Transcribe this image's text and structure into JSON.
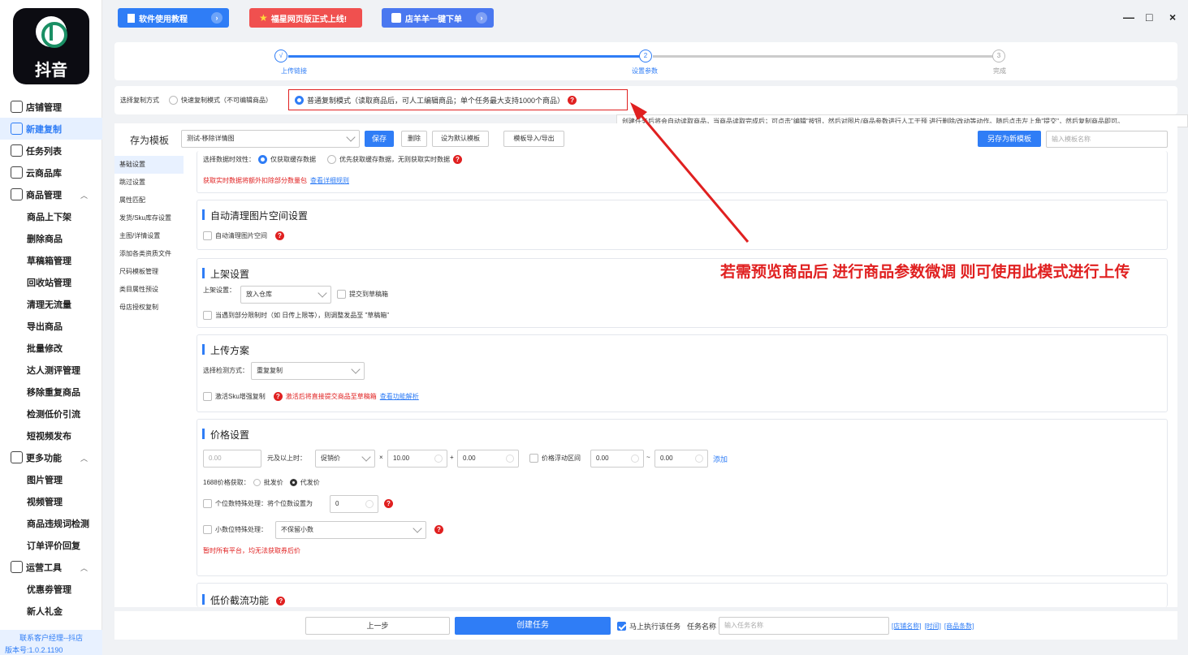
{
  "brand": {
    "name": "抖音"
  },
  "sidebar": {
    "items": [
      {
        "label": "店铺管理",
        "icon": "store-icon"
      },
      {
        "label": "新建复制",
        "icon": "add-copy-icon",
        "active": true
      },
      {
        "label": "任务列表",
        "icon": "task-list-icon"
      },
      {
        "label": "云商品库",
        "icon": "cloud-library-icon"
      },
      {
        "label": "商品管理",
        "icon": "cube-icon",
        "expandable": true
      }
    ],
    "goods_sub": [
      "商品上下架",
      "删除商品",
      "草稿箱管理",
      "回收站管理",
      "清理无流量",
      "导出商品",
      "批量修改",
      "达人测评管理",
      "移除重复商品",
      "检测低价引流",
      "短视频发布"
    ],
    "more": {
      "label": "更多功能",
      "icon": "grid-icon"
    },
    "more_sub": [
      "图片管理",
      "视频管理",
      "商品违规词检测",
      "订单评价回复"
    ],
    "ops": {
      "label": "运营工具",
      "icon": "tools-icon"
    },
    "ops_sub": [
      "优惠劵管理",
      "新人礼金"
    ],
    "contact": "联系客户经理--抖店",
    "version": "版本号:1.0.2.1190"
  },
  "topbar": {
    "tutorial": "软件使用教程",
    "web_launch": "福星网页版正式上线!",
    "order": "店羊羊一键下单",
    "minimize": "—",
    "maximize": "□",
    "close": "×"
  },
  "stepper": {
    "steps": [
      {
        "num": "√",
        "label": "上传链接"
      },
      {
        "num": "2",
        "label": "设置参数"
      },
      {
        "num": "3",
        "label": "完成"
      }
    ]
  },
  "copy_mode": {
    "label": "选择复制方式",
    "fast": "快速复制模式（不可编辑商品）",
    "normal": "普通复制模式（读取商品后，可人工编辑商品；单个任务最大支持1000个商品）",
    "tooltip": "创建任务后将会自动读取商品，当商品读取完成后；可点击\"编辑\"按钮，然后对图片/商品参数进行人工干预 进行删除/改动等动作。随后点击左上角\"提交\"，然后复制商品即可。"
  },
  "template": {
    "label": "存为模板",
    "selected": "测试-移除详情图",
    "save": "保存",
    "delete": "删除",
    "set_default": "设为默认模板",
    "import_export": "模板导入/导出",
    "save_new": "另存为新模板",
    "name_placeholder": "输入模板名称"
  },
  "settings_nav": [
    "基础设置",
    "跳过设置",
    "属性匹配",
    "发货/Sku库存设置",
    "主图/详情设置",
    "添加各类资质文件",
    "尺码模板管理",
    "类目属性预设",
    "母店授权复制"
  ],
  "basic": {
    "timeliness": "选择数据时效性：",
    "cache_only": "仅获取缓存数据",
    "cache_first": "优先获取缓存数据，无则获取实时数据",
    "realtime_note": "获取实时数据将额外扣除部分数量包",
    "rules_link": "查看详细规则"
  },
  "auto_clean": {
    "title": "自动清理图片空间设置",
    "option": "自动清理图片空间"
  },
  "listing": {
    "title": "上架设置",
    "label": "上架设置：",
    "value": "放入仓库",
    "submit_draft": "提交到草稿箱",
    "limit_note": "当遇到部分限制时（如 日传上限等），则调整发品至 \"草稿箱\""
  },
  "upload_plan": {
    "title": "上传方案",
    "detect_label": "选择检测方式：",
    "detect_value": "重复复制",
    "sku_enhance": "激活Sku增强复制",
    "sku_note": "激活后将直接提交商品至草稿箱",
    "sku_link": "查看功能解析"
  },
  "price": {
    "title": "价格设置",
    "min_placeholder": "0.00",
    "above_label": "元及以上时：",
    "price_type": "促销价",
    "times": "×",
    "multiplier": "10.00",
    "plus": "+",
    "addend": "0.00",
    "float_label": "价格浮动区间",
    "float_min": "0.00",
    "tilde": "~",
    "float_max": "0.00",
    "add_link": "添加",
    "source_label": "1688价格获取：",
    "wholesale": "批发价",
    "dropship": "代发价",
    "units_label": "个位数特殊处理：将个位数设置为",
    "units_value": "0",
    "decimal_label": "小数位特殊处理：",
    "decimal_value": "不保留小数",
    "notice": "暂时所有平台，均无法获取券后价"
  },
  "low_price": {
    "title": "低价截流功能"
  },
  "bottom": {
    "prev": "上一步",
    "create": "创建任务",
    "run_now": "马上执行该任务",
    "task_name_label": "任务名称",
    "task_name_placeholder": "输入任务名称",
    "tag_shop": "[店铺名称]",
    "tag_time": "[时间]",
    "tag_count": "[商品条数]"
  },
  "annotation": "若需预览商品后 进行商品参数微调 则可使用此模式进行上传",
  "colors": {
    "accent": "#2f7df6",
    "danger": "#e02020"
  }
}
